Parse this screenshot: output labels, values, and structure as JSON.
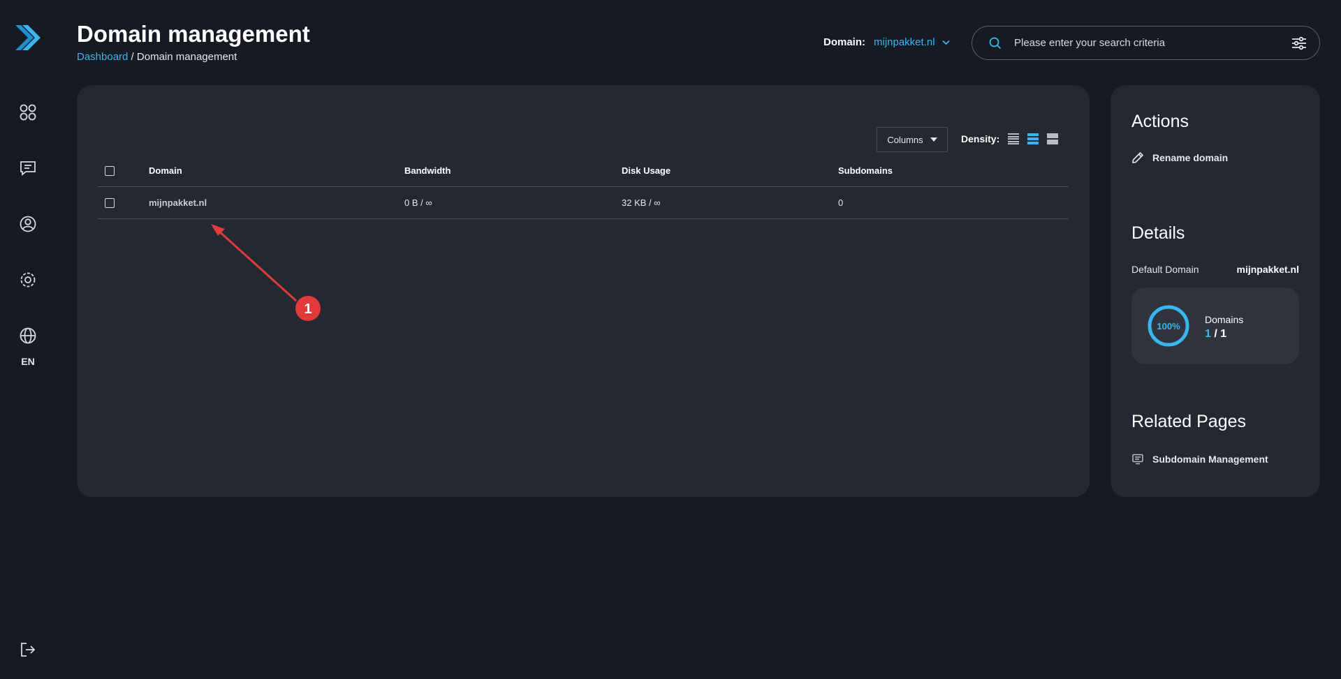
{
  "colors": {
    "background": "#161a22",
    "card": "#242830",
    "accent": "#39b6ee",
    "annotation": "#e23a3a"
  },
  "sidebar": {
    "logo_icon": "chevron-logo-icon",
    "items": [
      {
        "icon": "apps-grid-icon"
      },
      {
        "icon": "chat-icon"
      },
      {
        "icon": "user-circle-icon"
      },
      {
        "icon": "settings-gear-icon"
      },
      {
        "icon": "globe-icon"
      }
    ],
    "language": "EN",
    "logout_icon": "logout-icon"
  },
  "header": {
    "title": "Domain management",
    "breadcrumb": {
      "link": "Dashboard",
      "separator": " / ",
      "current": "Domain management"
    },
    "domain_label": "Domain:",
    "domain_value": "mijnpakket.nl",
    "search_placeholder": "Please enter your search criteria"
  },
  "toolbar": {
    "columns_label": "Columns",
    "density_label": "Density:"
  },
  "table": {
    "headers": [
      "Domain",
      "Bandwidth",
      "Disk Usage",
      "Subdomains"
    ],
    "rows": [
      {
        "domain": "mijnpakket.nl",
        "bandwidth": "0 B / ∞",
        "disk_usage": "32 KB / ∞",
        "subdomains": "0"
      }
    ]
  },
  "annotation": {
    "number": "1"
  },
  "panel": {
    "actions_title": "Actions",
    "rename_label": "Rename domain",
    "details_title": "Details",
    "default_domain_label": "Default Domain",
    "default_domain_value": "mijnpakket.nl",
    "stat": {
      "percent_label": "100%",
      "percent": 100,
      "title": "Domains",
      "current": "1",
      "separator": " / ",
      "total": "1"
    },
    "related_title": "Related Pages",
    "related_label": "Subdomain Management"
  }
}
